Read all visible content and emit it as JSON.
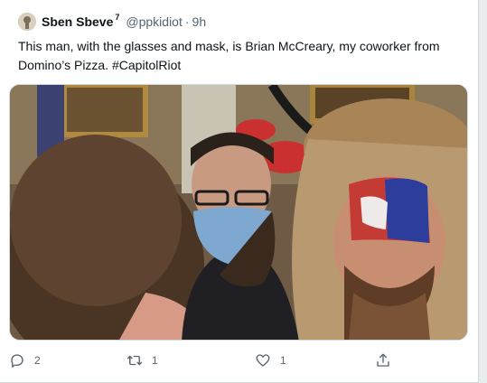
{
  "tweet": {
    "author_name": "Sben Sbeve",
    "author_badge": "7",
    "handle": "@ppkidiot",
    "separator": "·",
    "time": "9h",
    "text": "This man, with the glasses and mask, is Brian McCreary, my coworker from Domino’s Pizza. #CapitolRiot"
  },
  "actions": {
    "reply_count": "2",
    "retweet_count": "1",
    "like_count": "1"
  },
  "icons": {
    "reply": "reply-icon",
    "retweet": "retweet-icon",
    "like": "heart-icon",
    "share": "share-icon"
  },
  "colors": {
    "text": "#0f1419",
    "secondary": "#536471",
    "border": "#cfd9de"
  }
}
